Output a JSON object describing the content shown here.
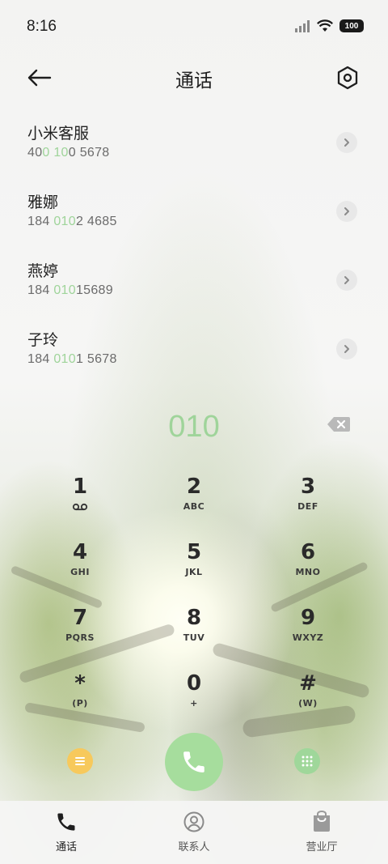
{
  "status": {
    "time": "8:16",
    "battery": "100"
  },
  "header": {
    "title": "通话"
  },
  "results": [
    {
      "name": "小米客服",
      "number_parts": [
        "40",
        "0 10",
        "0 5678"
      ]
    },
    {
      "name": "雅娜",
      "number_parts": [
        "184 ",
        "010",
        "2 4685"
      ]
    },
    {
      "name": "燕婷",
      "number_parts": [
        "184 ",
        "010",
        "15689"
      ]
    },
    {
      "name": "子玲",
      "number_parts": [
        "184 ",
        "010",
        "1 5678"
      ]
    }
  ],
  "dial": {
    "input": "010"
  },
  "keypad": [
    {
      "digit": "1",
      "sub": ""
    },
    {
      "digit": "2",
      "sub": "ABC"
    },
    {
      "digit": "3",
      "sub": "DEF"
    },
    {
      "digit": "4",
      "sub": "GHI"
    },
    {
      "digit": "5",
      "sub": "JKL"
    },
    {
      "digit": "6",
      "sub": "MNO"
    },
    {
      "digit": "7",
      "sub": "PQRS"
    },
    {
      "digit": "8",
      "sub": "TUV"
    },
    {
      "digit": "9",
      "sub": "WXYZ"
    },
    {
      "digit": "*",
      "sub": "(P)"
    },
    {
      "digit": "0",
      "sub": "+"
    },
    {
      "digit": "#",
      "sub": "(W)"
    }
  ],
  "icons": {
    "key1_sub": "voicemail-icon",
    "menu": "menu-icon",
    "call": "phone-icon",
    "keypad_toggle": "dialpad-icon",
    "back": "arrow-left-icon",
    "settings": "settings-hexagon-icon",
    "backspace": "backspace-icon"
  },
  "colors": {
    "highlight": "#9fd49a",
    "call_button": "#a6dd9d",
    "menu_button": "#f7c95c",
    "dialpad_button": "#9fd79a"
  },
  "bottom_nav": [
    {
      "label": "通话",
      "icon": "phone-icon",
      "active": true
    },
    {
      "label": "联系人",
      "icon": "contact-icon",
      "active": false
    },
    {
      "label": "营业厅",
      "icon": "store-bag-icon",
      "active": false
    }
  ]
}
